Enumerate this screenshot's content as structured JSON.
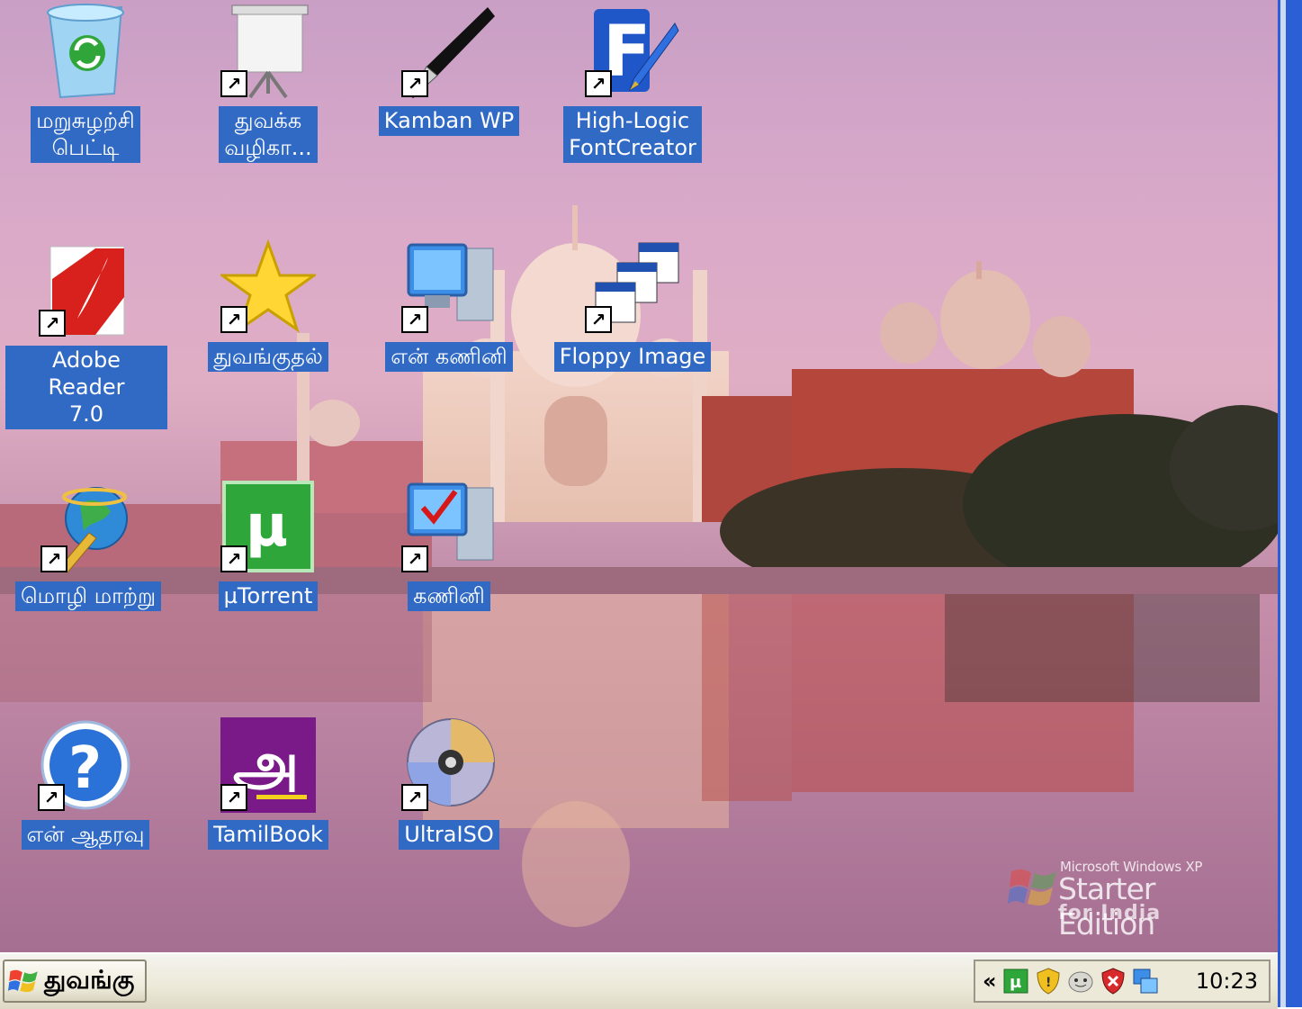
{
  "desktop": {
    "icons": [
      {
        "label": "மறுசுழற்சி\nபெட்டி",
        "icon": "recycle-bin-icon"
      },
      {
        "label": "துவக்க\nவழிகா...",
        "icon": "presentation-board-icon"
      },
      {
        "label": "Kamban WP",
        "icon": "fountain-pen-icon"
      },
      {
        "label": "High-Logic\nFontCreator",
        "icon": "fontcreator-icon"
      },
      {
        "label": "Adobe Reader\n7.0",
        "icon": "adobe-reader-icon"
      },
      {
        "label": "துவங்குதல்",
        "icon": "star-icon"
      },
      {
        "label": "என் கணினி",
        "icon": "my-computer-icon"
      },
      {
        "label": "Floppy Image",
        "icon": "floppy-image-icon"
      },
      {
        "label": "மொழி மாற்று",
        "icon": "globe-pen-icon"
      },
      {
        "label": "µTorrent",
        "icon": "utorrent-icon"
      },
      {
        "label": "கணினி",
        "icon": "computer-check-icon"
      },
      {
        "label": "என் ஆதரவு",
        "icon": "help-icon"
      },
      {
        "label": "TamilBook",
        "icon": "tamilbook-icon"
      },
      {
        "label": "UltraISO",
        "icon": "disc-icon"
      }
    ]
  },
  "watermark": {
    "line1": "Microsoft Windows XP",
    "line2": "Starter Edition",
    "line3": "for India"
  },
  "taskbar": {
    "start_label": "துவங்கு",
    "tray_expand": "«",
    "tray_icons": [
      "utorrent-tray-icon",
      "security-shield-icon",
      "messenger-icon",
      "antivirus-icon",
      "network-icon"
    ],
    "clock": "10:23"
  },
  "colors": {
    "label_bg": "#316ac5",
    "taskbar_bg": "#ece9d8",
    "right_edge": "#2a5fd6"
  }
}
